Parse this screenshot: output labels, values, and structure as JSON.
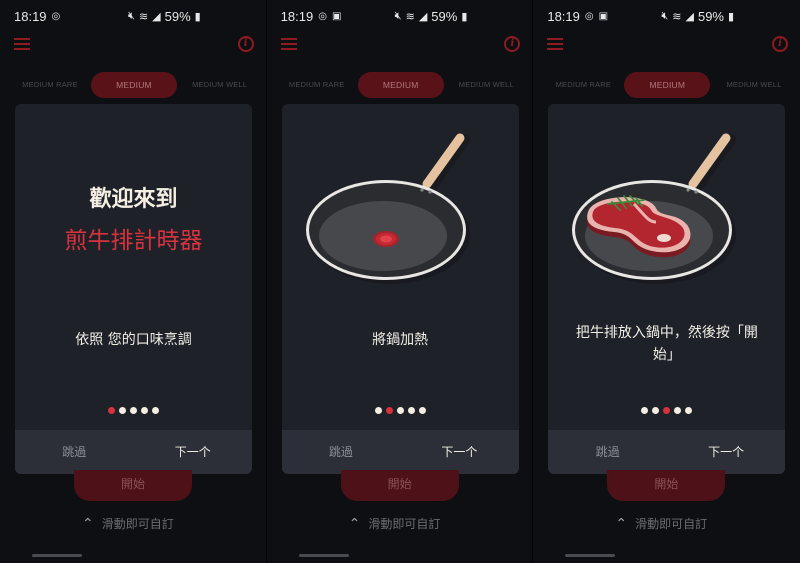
{
  "status_bar": {
    "time": "18:19",
    "battery": "59%",
    "icons": [
      "notification-badge-icon",
      "gallery-icon",
      "mute-icon",
      "wifi-icon",
      "signal-icon",
      "battery-icon"
    ]
  },
  "header": {
    "menu_icon": "hamburger-icon",
    "info_icon": "info-icon",
    "accent_color": "#8e1a22"
  },
  "doneness_tabs": [
    {
      "label": "MEDIUM RARE",
      "active": false
    },
    {
      "label": "MEDIUM",
      "active": true
    },
    {
      "label": "MEDIUM WELL",
      "active": false
    }
  ],
  "screens": [
    {
      "title_line1": "歡迎來到",
      "title_line2": "煎牛排計時器",
      "description": "依照 您的口味烹調",
      "illustration": null,
      "active_dot": 0
    },
    {
      "description": "將鍋加熱",
      "illustration": "frying-pan",
      "active_dot": 1
    },
    {
      "description": "把牛排放入鍋中，然後按「開始」",
      "illustration": "steak-in-pan",
      "active_dot": 2
    }
  ],
  "pagination_total": 5,
  "footer": {
    "skip_label": "跳過",
    "next_label": "下一个"
  },
  "start_button": "開始",
  "swipe_hint": "滑動即可自訂",
  "colors": {
    "highlight": "#d8323f",
    "card": "#1f2129",
    "footer": "#2c2f38",
    "start": "#4e1117"
  }
}
